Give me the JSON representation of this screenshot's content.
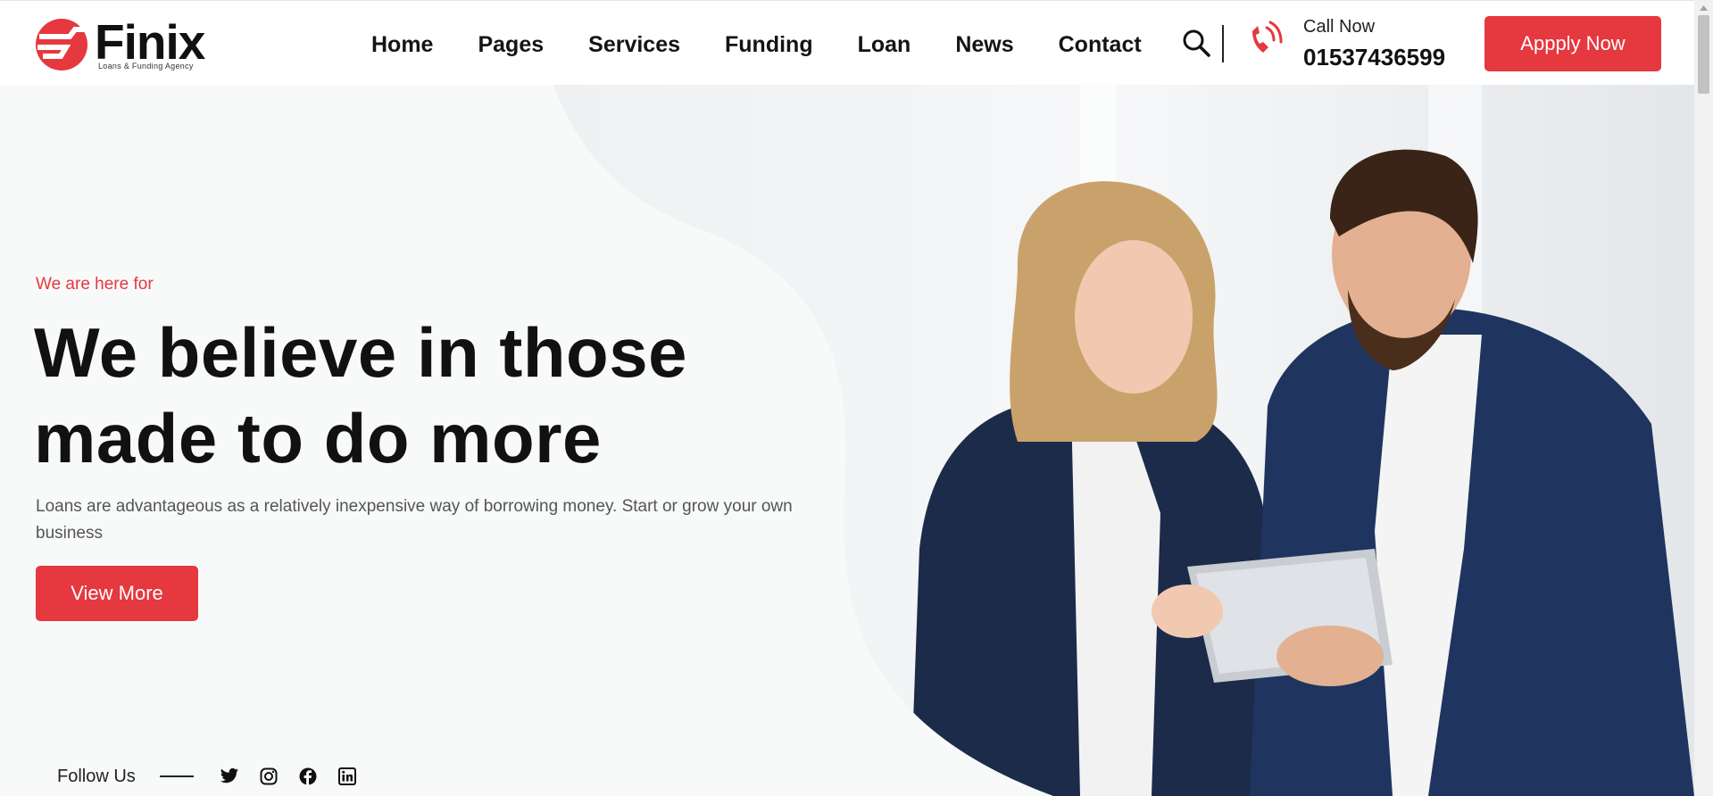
{
  "brand": {
    "name": "Finix",
    "tagline": "Loans & Funding Agency",
    "accent_color": "#e5383f"
  },
  "nav": {
    "items": [
      {
        "label": "Home"
      },
      {
        "label": "Pages"
      },
      {
        "label": "Services"
      },
      {
        "label": "Funding"
      },
      {
        "label": "Loan"
      },
      {
        "label": "News"
      },
      {
        "label": "Contact"
      }
    ]
  },
  "header": {
    "search_icon": "search-icon",
    "phone_icon": "phone-ringing-icon",
    "call_label": "Call Now",
    "call_number": "01537436599",
    "apply_label": "Appply Now"
  },
  "hero": {
    "eyebrow": "We are here for",
    "headline": "We believe in those made to do more",
    "description": "Loans are advantageous as a relatively inexpensive way of borrowing money. Start or grow your own business",
    "button_label": "View More",
    "image": "two-business-people-with-tablet-photo"
  },
  "follow": {
    "label": "Follow Us",
    "socials": [
      {
        "icon": "twitter-icon"
      },
      {
        "icon": "instagram-icon"
      },
      {
        "icon": "facebook-icon"
      },
      {
        "icon": "linkedin-icon"
      }
    ]
  }
}
